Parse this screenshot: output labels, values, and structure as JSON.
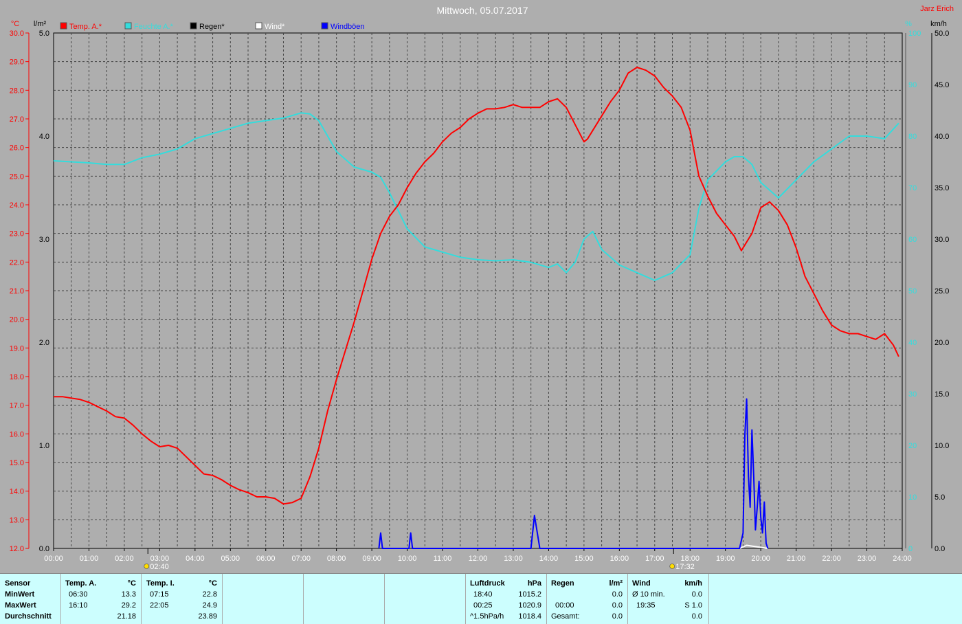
{
  "header": {
    "title": "Mittwoch, 05.07.2017",
    "station": "Jarz Erich"
  },
  "colors": {
    "background": "#aeaeae",
    "temp": "#ff0000",
    "humidity": "#33dddd",
    "rain": "#000000",
    "wind": "#ffffff",
    "gusts": "#0000ff",
    "stats_bg": "#ccfefe"
  },
  "legend": [
    {
      "label": "Temp. A.*",
      "color": "#ff0000"
    },
    {
      "label": "Feuchte A.*",
      "color": "#33dddd"
    },
    {
      "label": "Regen*",
      "color": "#000000"
    },
    {
      "label": "Wind*",
      "color": "#ffffff"
    },
    {
      "label": "Windböen",
      "color": "#0000ff"
    }
  ],
  "axes": {
    "temp_unit": "°C",
    "rain_unit": "l/m²",
    "hum_unit": "%",
    "wind_unit": "km/h",
    "temp_ticks": [
      "30.0",
      "29.0",
      "28.0",
      "27.0",
      "26.0",
      "25.0",
      "24.0",
      "23.0",
      "22.0",
      "21.0",
      "20.0",
      "19.0",
      "18.0",
      "17.0",
      "16.0",
      "15.0",
      "14.0",
      "13.0",
      "12.0"
    ],
    "rain_ticks": [
      "5.0",
      "4.0",
      "3.0",
      "2.0",
      "1.0",
      "0.0"
    ],
    "hum_ticks": [
      "100",
      "90",
      "80",
      "70",
      "60",
      "50",
      "40",
      "30",
      "20",
      "10",
      "0"
    ],
    "wind_ticks": [
      "50.0",
      "45.0",
      "40.0",
      "35.0",
      "30.0",
      "25.0",
      "20.0",
      "15.0",
      "10.0",
      "5.0",
      "0.0"
    ],
    "x_ticks": [
      "00:00",
      "01:00",
      "02:00",
      "03:00",
      "04:00",
      "05:00",
      "06:00",
      "07:00",
      "08:00",
      "09:00",
      "10:00",
      "11:00",
      "12:00",
      "13:00",
      "14:00",
      "15:00",
      "16:00",
      "17:00",
      "18:00",
      "19:00",
      "20:00",
      "21:00",
      "22:00",
      "23:00",
      "24:00"
    ]
  },
  "sun": {
    "sunrise": "02:40",
    "sunset": "17:32"
  },
  "chart_data": {
    "type": "line",
    "title": "Mittwoch, 05.07.2017",
    "xlim": [
      0,
      24
    ],
    "temp_ylim": [
      12,
      30
    ],
    "rain_ylim": [
      0,
      5
    ],
    "humidity_ylim": [
      0,
      100
    ],
    "wind_ylim": [
      0,
      50
    ],
    "grid": true,
    "series": [
      {
        "name": "Temp. A.*",
        "axis": "temp",
        "x": [
          0,
          0.25,
          0.5,
          0.75,
          1,
          1.25,
          1.5,
          1.75,
          2,
          2.25,
          2.5,
          2.75,
          3,
          3.25,
          3.5,
          3.75,
          4,
          4.25,
          4.5,
          4.75,
          5,
          5.25,
          5.5,
          5.75,
          6,
          6.25,
          6.5,
          6.75,
          7,
          7.25,
          7.5,
          7.75,
          8,
          8.25,
          8.5,
          8.75,
          9,
          9.25,
          9.5,
          9.75,
          10,
          10.25,
          10.5,
          10.75,
          11,
          11.25,
          11.5,
          11.75,
          12,
          12.25,
          12.5,
          12.75,
          13,
          13.25,
          13.5,
          13.75,
          14,
          14.25,
          14.5,
          14.75,
          15,
          15.1,
          15.25,
          15.5,
          15.75,
          16,
          16.25,
          16.5,
          16.75,
          17,
          17.25,
          17.5,
          17.75,
          18,
          18.25,
          18.5,
          18.75,
          19,
          19.25,
          19.45,
          19.75,
          20,
          20.25,
          20.5,
          20.75,
          21,
          21.25,
          21.5,
          21.75,
          22,
          22.25,
          22.5,
          22.75,
          23,
          23.25,
          23.5,
          23.75,
          23.9
        ],
        "y": [
          17.3,
          17.3,
          17.25,
          17.2,
          17.1,
          16.95,
          16.8,
          16.6,
          16.55,
          16.3,
          16.0,
          15.75,
          15.55,
          15.6,
          15.5,
          15.2,
          14.9,
          14.6,
          14.55,
          14.4,
          14.2,
          14.05,
          13.95,
          13.8,
          13.8,
          13.75,
          13.55,
          13.6,
          13.75,
          14.5,
          15.5,
          16.8,
          17.9,
          18.9,
          19.9,
          21.0,
          22.1,
          23.0,
          23.6,
          24.0,
          24.6,
          25.1,
          25.5,
          25.8,
          26.2,
          26.5,
          26.7,
          27.0,
          27.2,
          27.35,
          27.35,
          27.4,
          27.5,
          27.4,
          27.4,
          27.4,
          27.6,
          27.7,
          27.4,
          26.8,
          26.2,
          26.3,
          26.6,
          27.1,
          27.6,
          28.0,
          28.6,
          28.8,
          28.7,
          28.5,
          28.1,
          27.8,
          27.4,
          26.6,
          25.0,
          24.3,
          23.7,
          23.3,
          22.9,
          22.4,
          23.0,
          23.9,
          24.1,
          23.8,
          23.3,
          22.5,
          21.5,
          20.9,
          20.3,
          19.8,
          19.6,
          19.5,
          19.5,
          19.4,
          19.3,
          19.5,
          19.1,
          18.7
        ]
      },
      {
        "name": "Feuchte A.*",
        "axis": "humidity",
        "x": [
          0,
          0.5,
          1,
          1.5,
          2,
          2.5,
          3,
          3.5,
          4,
          4.5,
          5,
          5.5,
          6,
          6.5,
          7,
          7.25,
          7.5,
          7.75,
          8,
          8.5,
          9,
          9.25,
          9.5,
          10,
          10.5,
          11,
          11.5,
          12,
          12.5,
          13,
          13.5,
          14,
          14.25,
          14.5,
          14.75,
          15,
          15.25,
          15.5,
          16,
          16.5,
          17,
          17.5,
          18,
          18.25,
          18.5,
          19,
          19.25,
          19.5,
          19.75,
          20,
          20.5,
          21,
          21.5,
          22,
          22.5,
          23,
          23.5,
          23.9
        ],
        "y": [
          75.2,
          75,
          74.8,
          74.5,
          74.5,
          75.8,
          76.5,
          77.5,
          79.5,
          80.5,
          81.5,
          82.5,
          83,
          83.5,
          84.5,
          84.3,
          83,
          80,
          77,
          74,
          73,
          72,
          69,
          62,
          58.5,
          57.5,
          56.5,
          56,
          55.8,
          56,
          55.5,
          54.5,
          55.2,
          53.5,
          55.5,
          60,
          61.5,
          58,
          55,
          53.5,
          52,
          53.5,
          57,
          66,
          71.5,
          75,
          76,
          76,
          74.5,
          71,
          68,
          71.5,
          75,
          77.5,
          80,
          80,
          79.5,
          82.5
        ]
      },
      {
        "name": "Windböen",
        "axis": "wind",
        "x": [
          9.2,
          9.25,
          9.3,
          10.05,
          10.1,
          10.15,
          13.5,
          13.6,
          13.75,
          19.4,
          19.5,
          19.55,
          19.6,
          19.65,
          19.7,
          19.75,
          19.8,
          19.85,
          19.9,
          19.95,
          20.0,
          20.05,
          20.1,
          20.15,
          20.2
        ],
        "y": [
          0,
          1.5,
          0,
          0,
          1.5,
          0,
          0,
          3.2,
          0,
          0,
          1.5,
          11,
          14.5,
          7,
          4,
          11.5,
          7,
          1.8,
          4,
          6.5,
          3,
          1.5,
          4.5,
          0.5,
          0
        ]
      },
      {
        "name": "Wind*",
        "axis": "wind",
        "x": [
          19.4,
          19.6,
          19.8,
          20.2
        ],
        "y": [
          0,
          0.3,
          0.2,
          0
        ]
      }
    ]
  },
  "stats": {
    "sensor": {
      "label": "Sensor",
      "rows": [
        "MinWert",
        "MaxWert",
        "Durchschnitt"
      ]
    },
    "temp_a": {
      "label": "Temp. A.",
      "unit": "°C",
      "min_time": "06:30",
      "min": "13.3",
      "max_time": "16:10",
      "max": "29.2",
      "avg": "21.18"
    },
    "temp_i": {
      "label": "Temp. I.",
      "unit": "°C",
      "min_time": "07:15",
      "min": "22.8",
      "max_time": "22:05",
      "max": "24.9",
      "avg": "23.89"
    },
    "pressure": {
      "label": "Luftdruck",
      "unit": "hPa",
      "r1_time": "18:40",
      "r1": "1015.2",
      "r2_time": "00:25",
      "r2": "1020.9",
      "r3_label": "^1.5hPa/h",
      "r3": "1018.4"
    },
    "rain": {
      "label": "Regen",
      "unit": "l/m²",
      "r2_time": "00:00",
      "r2": "0.0",
      "r3_label": "Gesamt:",
      "r3": "0.0",
      "r1": "0.0"
    },
    "wind": {
      "label": "Wind",
      "unit": "km/h",
      "r1_label": "Ø 10 min.",
      "r1": "0.0",
      "r2_time": "19:35",
      "r2": "S 1.0",
      "r3": "0.0"
    }
  }
}
